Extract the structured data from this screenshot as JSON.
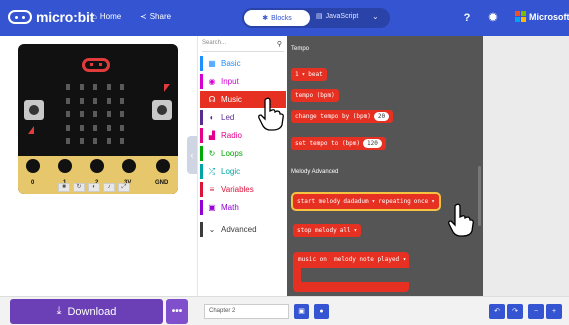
{
  "header": {
    "logo_text": "micro:bit",
    "home_label": "Home",
    "share_label": "Share",
    "blocks_label": "Blocks",
    "javascript_label": "JavaScript",
    "brand_label": "Microsoft",
    "help_icon": "question-icon",
    "settings_icon": "gear-icon",
    "colors": {
      "bar": "#3454d1",
      "toggle_bg": "#2a43a8"
    }
  },
  "simulator": {
    "pins": [
      "0",
      "1",
      "2",
      "3V",
      "GND"
    ],
    "controls": [
      "stop-icon",
      "restart-icon",
      "slowmo-icon",
      "mute-icon",
      "fullscreen-icon"
    ]
  },
  "toolbox": {
    "search_placeholder": "Search...",
    "categories": [
      {
        "label": "Basic",
        "color": "#1e90ff",
        "icon": "grid-icon"
      },
      {
        "label": "Input",
        "color": "#d400d4",
        "icon": "circle-icon"
      },
      {
        "label": "Music",
        "color": "#e63022",
        "icon": "headphones-icon"
      },
      {
        "label": "Led",
        "color": "#5c2d91",
        "icon": "toggle-icon"
      },
      {
        "label": "Radio",
        "color": "#e3008c",
        "icon": "signal-icon"
      },
      {
        "label": "Loops",
        "color": "#00aa00",
        "icon": "loop-icon"
      },
      {
        "label": "Logic",
        "color": "#00a4a6",
        "icon": "shuffle-icon"
      },
      {
        "label": "Variables",
        "color": "#dc143c",
        "icon": "list-icon"
      },
      {
        "label": "Math",
        "color": "#9400d3",
        "icon": "calculator-icon"
      },
      {
        "label": "Advanced",
        "color": "#3c3c3c",
        "icon": "chevron-down-icon"
      }
    ],
    "active_category": "Music"
  },
  "workspace": {
    "sections": [
      "Tempo",
      "Melody Advanced"
    ],
    "blocks": {
      "beat": {
        "value": "1",
        "suffix": "beat"
      },
      "tempo": "tempo (bpm)",
      "change_tempo": {
        "text": "change tempo by (bpm)",
        "value": "20"
      },
      "set_tempo": {
        "text": "set tempo to (bpm)",
        "value": "120"
      },
      "start_melody": {
        "text": "start melody",
        "melody": "dadadum",
        "repeat_text": "repeating",
        "repeat_value": "once"
      },
      "stop_melody": {
        "text": "stop melody",
        "value": "all"
      },
      "music_on": {
        "text": "music on",
        "value": "melody note played"
      }
    },
    "colors": {
      "background": "#555555",
      "block": "#e63022",
      "selection": "#f5c242"
    }
  },
  "bottom": {
    "download_label": "Download",
    "more_label": "•••",
    "project_name": "Chapter 2"
  }
}
